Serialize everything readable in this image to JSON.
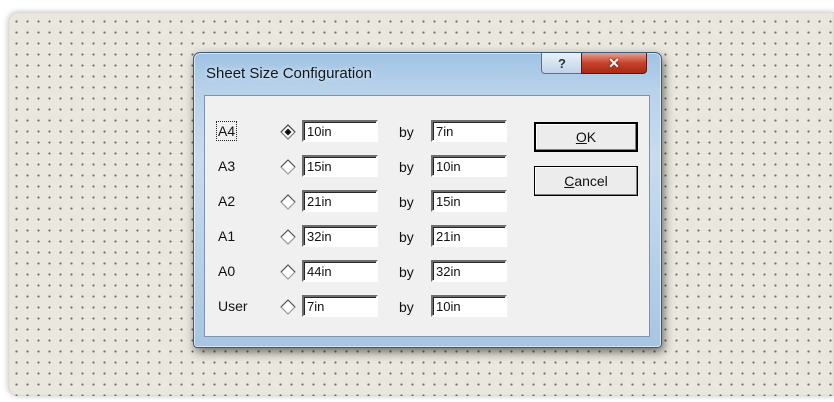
{
  "dialog": {
    "title": "Sheet Size Configuration",
    "help_label": "?",
    "close_label": "✕"
  },
  "rows": [
    {
      "label": "A4",
      "width": "10in",
      "height": "7in",
      "selected": true
    },
    {
      "label": "A3",
      "width": "15in",
      "height": "10in",
      "selected": false
    },
    {
      "label": "A2",
      "width": "21in",
      "height": "15in",
      "selected": false
    },
    {
      "label": "A1",
      "width": "32in",
      "height": "21in",
      "selected": false
    },
    {
      "label": "A0",
      "width": "44in",
      "height": "32in",
      "selected": false
    },
    {
      "label": "User",
      "width": "7in",
      "height": "10in",
      "selected": false
    }
  ],
  "by_label": "by",
  "buttons": {
    "ok_label": "OK",
    "ok_mnemonic": "O",
    "ok_rest": "K",
    "cancel_label": "Cancel",
    "cancel_mnemonic": "C",
    "cancel_rest": "ancel"
  }
}
